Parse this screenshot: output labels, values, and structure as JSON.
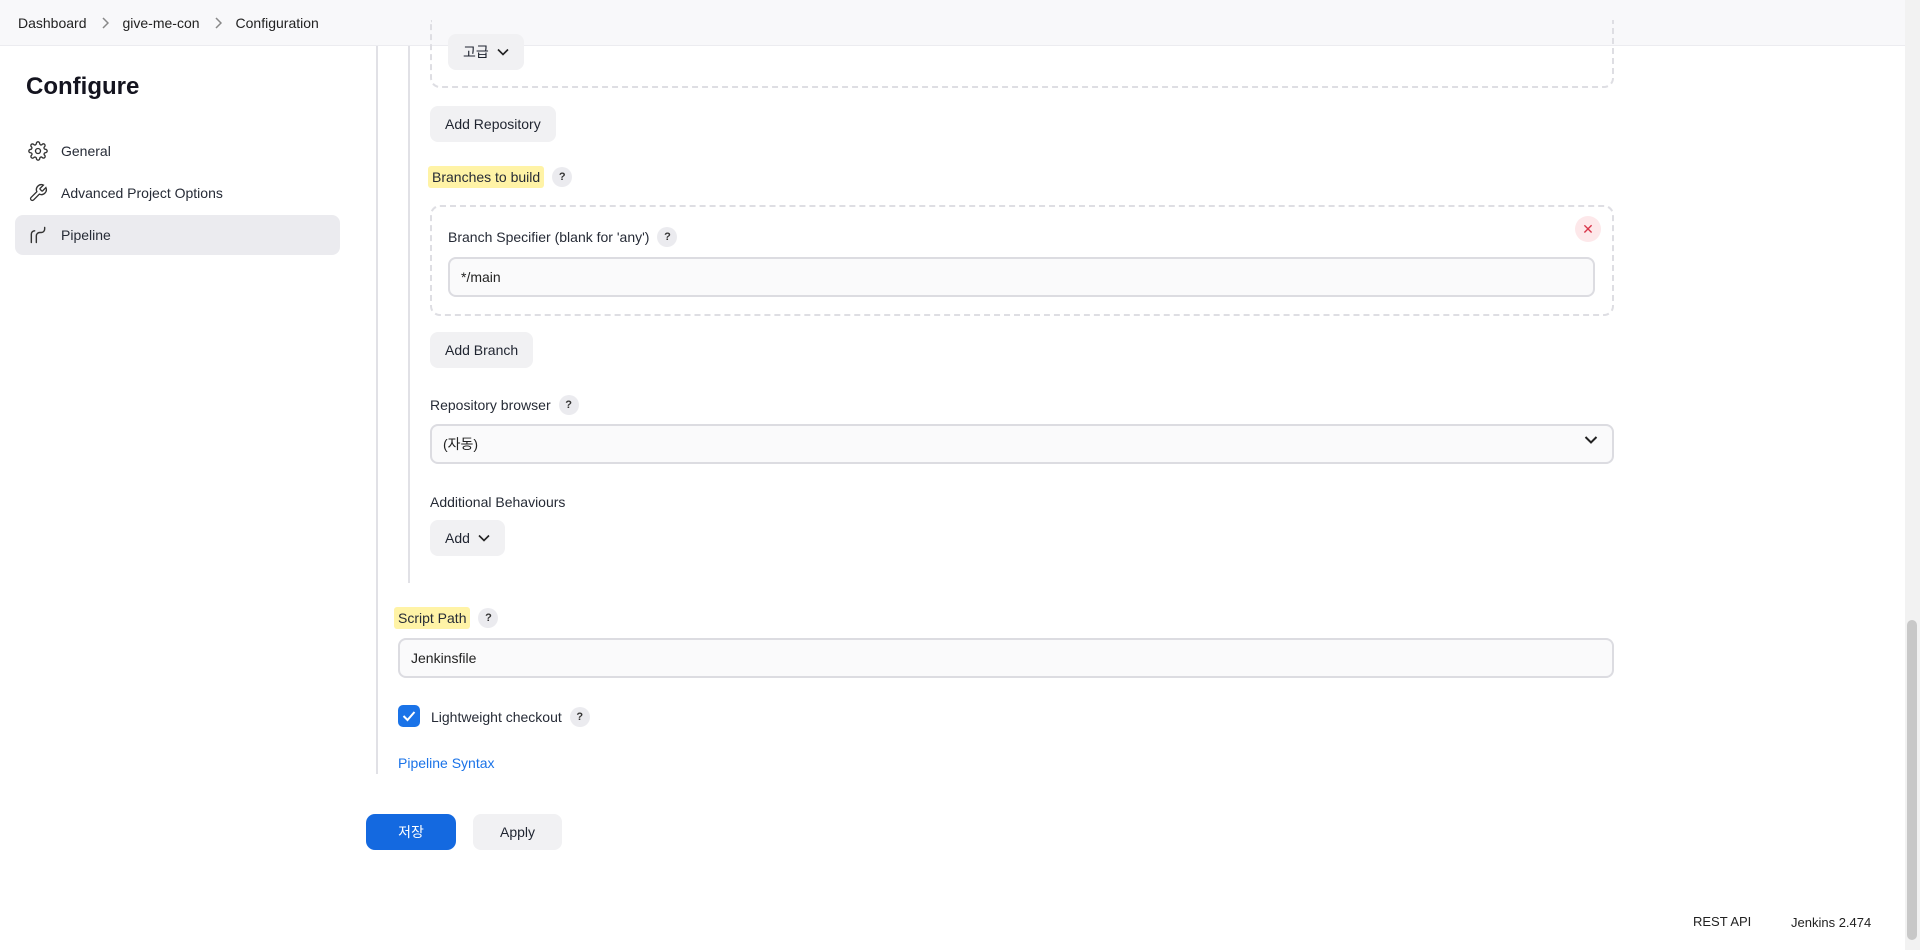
{
  "breadcrumb": {
    "items": [
      "Dashboard",
      "give-me-con",
      "Configuration"
    ]
  },
  "sidebar": {
    "title": "Configure",
    "items": [
      {
        "label": "General",
        "icon": "gear-icon"
      },
      {
        "label": "Advanced Project Options",
        "icon": "wrench-icon"
      },
      {
        "label": "Pipeline",
        "icon": "pipeline-icon",
        "active": true
      }
    ]
  },
  "scm": {
    "advanced_label": "고급",
    "add_repository_label": "Add Repository",
    "branches_label": "Branches to build",
    "branch_specifier_label": "Branch Specifier (blank for 'any')",
    "branch_specifier_value": "*/main",
    "add_branch_label": "Add Branch",
    "repo_browser_label": "Repository browser",
    "repo_browser_value": "(자동)",
    "additional_behaviours_label": "Additional Behaviours",
    "add_label": "Add"
  },
  "pipeline": {
    "script_path_label": "Script Path",
    "script_path_value": "Jenkinsfile",
    "lightweight_label": "Lightweight checkout",
    "lightweight_checked": true,
    "pipeline_syntax_link": "Pipeline Syntax"
  },
  "actions": {
    "save_label": "저장",
    "apply_label": "Apply"
  },
  "footer": {
    "rest_api": "REST API",
    "version": "Jenkins 2.474"
  },
  "colors": {
    "accent": "#1469e0",
    "highlight": "#fff3a6",
    "danger": "#d9364a"
  }
}
